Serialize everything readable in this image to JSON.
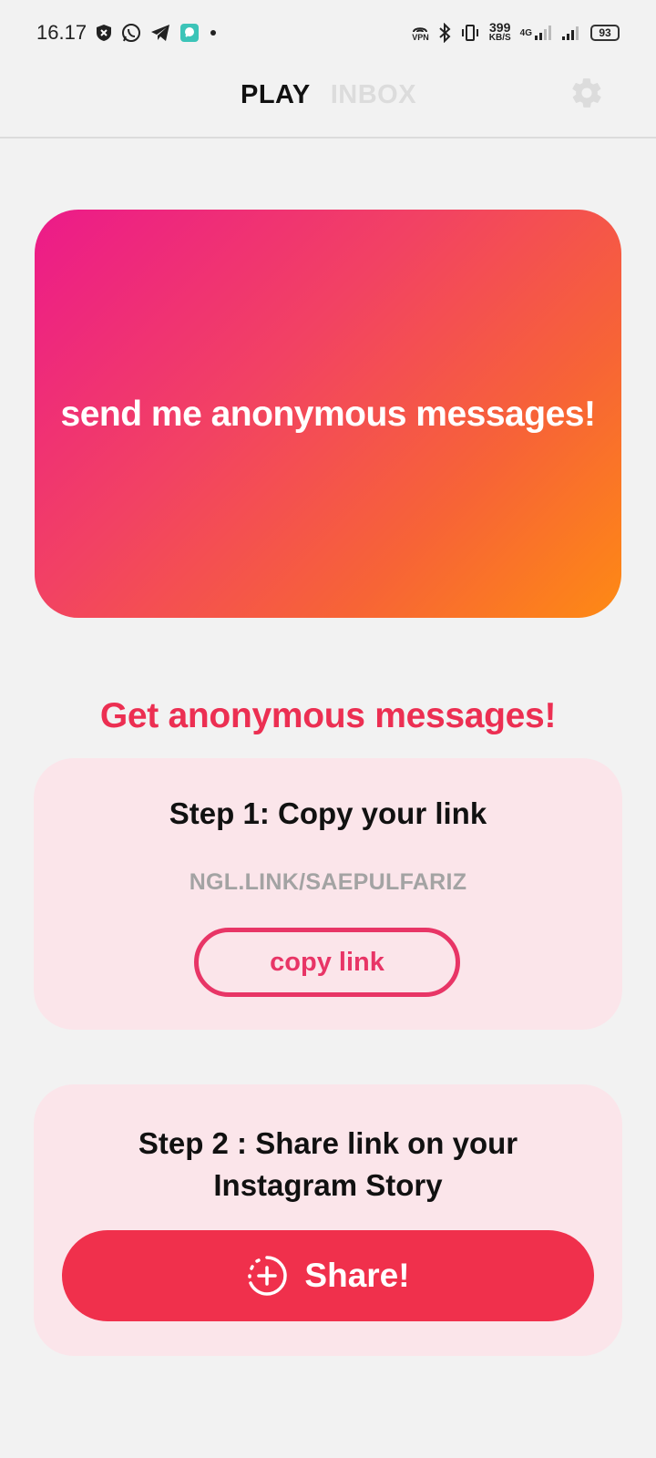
{
  "status_bar": {
    "time": "16.17",
    "network_speed_value": "399",
    "network_speed_unit": "KB/S",
    "network_type": "4G",
    "vpn_label": "VPN",
    "battery_level": "93"
  },
  "header": {
    "tabs": [
      {
        "label": "PLAY",
        "active": true
      },
      {
        "label": "INBOX",
        "active": false
      }
    ],
    "settings_icon": "gear-icon"
  },
  "hero": {
    "text": "send me anonymous messages!",
    "gradient_start": "#ec1a8a",
    "gradient_end": "#fe8a14"
  },
  "main": {
    "headline": "Get anonymous messages!",
    "step1": {
      "title": "Step 1: Copy your link",
      "link": "NGL.LINK/SAEPULFARIZ",
      "button_label": "copy link"
    },
    "step2": {
      "title_line1": "Step 2 : Share link on your",
      "title_line2": "Instagram Story",
      "button_label": "Share!",
      "button_icon": "story-add-icon"
    }
  },
  "colors": {
    "accent": "#ec2f52",
    "share_button": "#f0304c",
    "card_background": "#fbe5ea",
    "copy_button_border": "#e83566"
  }
}
